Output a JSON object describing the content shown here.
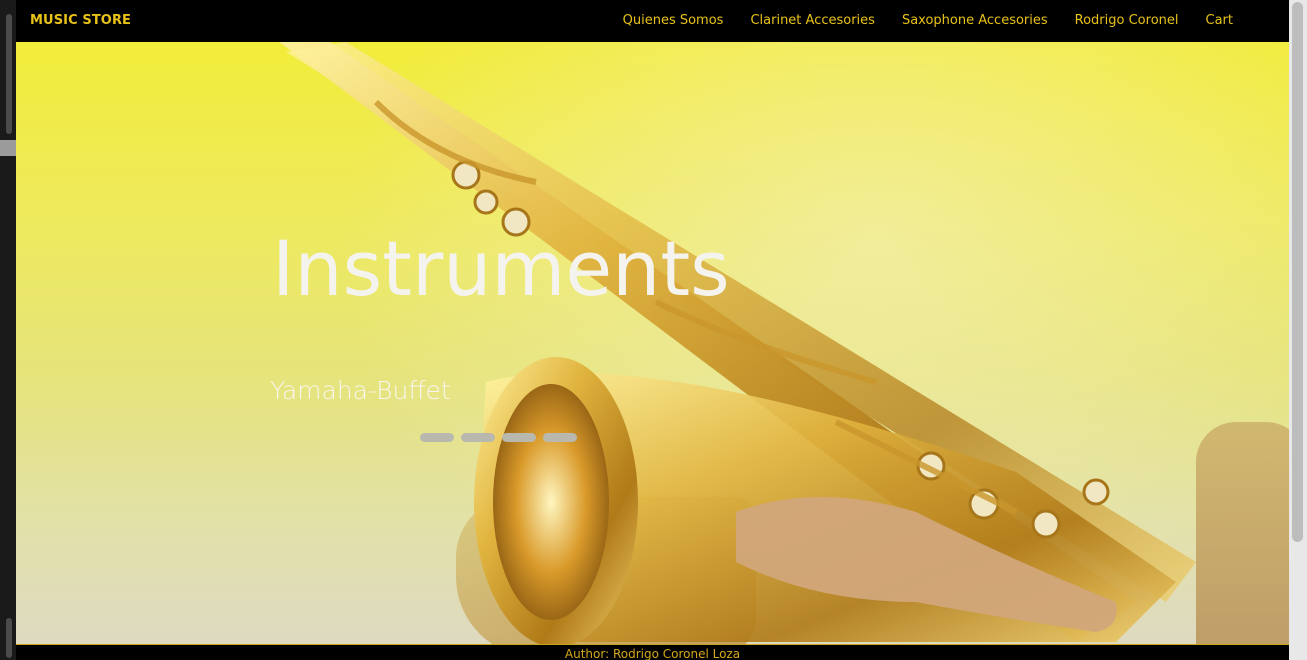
{
  "navbar": {
    "brand": "MUSIC STORE",
    "links": [
      "Quienes Somos",
      "Clarinet Accesories",
      "Saxophone Accesories",
      "Rodrigo Coronel",
      "Cart"
    ]
  },
  "hero": {
    "title": "Instruments",
    "subtitle": "Yamaha-Buffet",
    "indicator_count": 4
  },
  "footer": {
    "text": "Author: Rodrigo Coronel Loza"
  },
  "colors": {
    "accent": "#e8c219",
    "navbar_bg": "#000000",
    "hero_tint": "#f2ec3a"
  }
}
